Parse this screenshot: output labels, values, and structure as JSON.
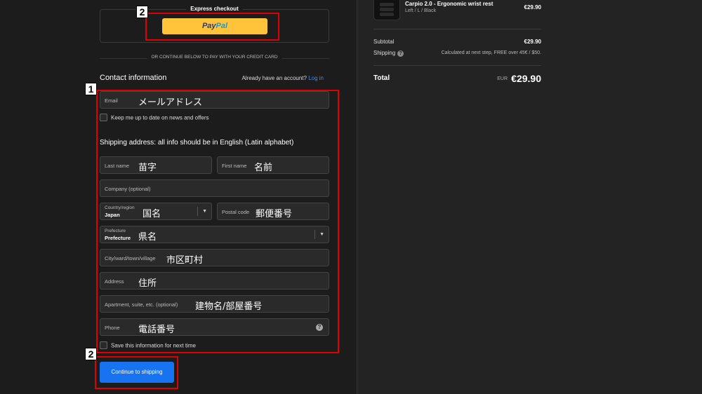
{
  "express": {
    "title": "Express checkout",
    "paypal_part1": "Pay",
    "paypal_part2": "Pal"
  },
  "divider_text": "OR CONTINUE BELOW TO PAY WITH YOUR CREDIT CARD",
  "contact": {
    "title": "Contact information",
    "account_prompt": "Already have an account?",
    "login_link": "Log in",
    "email_label": "Email",
    "email_note": "メールアドレス",
    "newsletter_label": "Keep me up to date on news and offers"
  },
  "shipping": {
    "title": "Shipping address: all info should be in English (Latin alphabet)",
    "last_name_label": "Last name",
    "last_name_note": "苗字",
    "first_name_label": "First name",
    "first_name_note": "名前",
    "company_label": "Company (optional)",
    "country_label": "Country/region",
    "country_value": "Japan",
    "country_note": "国名",
    "postal_label": "Postal code",
    "postal_note": "郵便番号",
    "prefecture_label": "Prefecture",
    "prefecture_value": "Prefecture",
    "prefecture_note": "県名",
    "city_label": "City/ward/town/village",
    "city_note": "市区町村",
    "address_label": "Address",
    "address_note": "住所",
    "apartment_label": "Apartment, suite, etc. (optional)",
    "apartment_note": "建物名/部屋番号",
    "phone_label": "Phone",
    "phone_note": "電話番号",
    "save_label": "Save this information for next time"
  },
  "continue_label": "Continue to shipping",
  "badges": {
    "one": "1",
    "two": "2"
  },
  "summary": {
    "product_name": "Carpio 2.0 - Ergonomic wrist rest",
    "product_variant": "Left / L / Black",
    "product_price": "€29.90",
    "subtotal_label": "Subtotal",
    "subtotal_value": "€29.90",
    "shipping_label": "Shipping",
    "shipping_note": "Calculated at next step, FREE over 45€ / $50.",
    "total_label": "Total",
    "total_currency": "EUR",
    "total_value": "€29.90"
  },
  "colors": {
    "accent": "#1773f0",
    "paypal": "#ffc439",
    "highlight": "#e00000",
    "link": "#2f8fff"
  }
}
